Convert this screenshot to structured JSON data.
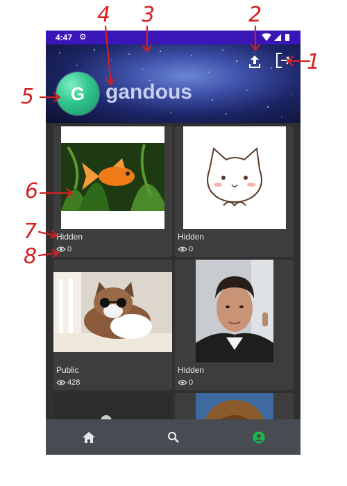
{
  "status_bar": {
    "time": "4:47"
  },
  "header": {
    "avatar_letter": "G",
    "username": "gandous"
  },
  "posts": [
    {
      "image": "goldfish-photo",
      "visibility": "Hidden",
      "views": "0"
    },
    {
      "image": "cartoon-cat-illustration",
      "visibility": "Hidden",
      "views": "0"
    },
    {
      "image": "cat-with-sunglasses-photo",
      "visibility": "Public",
      "views": "428"
    },
    {
      "image": "man-selfie-photo",
      "visibility": "Hidden",
      "views": "0"
    },
    {
      "image": "dark-photo",
      "visibility": "",
      "views": ""
    },
    {
      "image": "person-head-photo",
      "visibility": "",
      "views": ""
    }
  ],
  "bottom_nav": {
    "items": [
      "home",
      "search",
      "profile"
    ],
    "active": "profile",
    "active_color": "#1bb84a"
  },
  "annotations": [
    "1",
    "2",
    "3",
    "4",
    "5",
    "6",
    "7",
    "8"
  ],
  "colors": {
    "status_bar": "#3a16b8",
    "background": "#303030",
    "card": "#3d3d3d",
    "nav": "#474b52",
    "annotation": "#d42020"
  }
}
